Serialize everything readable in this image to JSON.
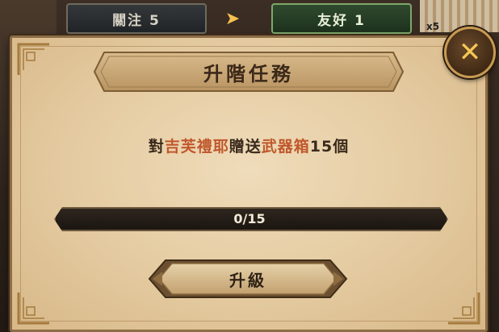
{
  "top_bar": {
    "follow_tab": "關注 5",
    "friend_tab": "友好 1",
    "corner_badge": "x5"
  },
  "dialog": {
    "title": "升階任務",
    "mission": {
      "prefix": "對",
      "target": "吉芙禮耶",
      "verb": "贈送",
      "item": "武器箱",
      "quantity": "15個"
    },
    "progress": {
      "current": 0,
      "total": 15,
      "label": "0/15"
    },
    "upgrade_button": "升級"
  },
  "colors": {
    "highlight": "#c0582c",
    "accent_gold": "#f4c657",
    "parchment": "#e4caa0"
  },
  "icons": {
    "close": "close-icon",
    "arrow": "chevron-right-icon"
  }
}
